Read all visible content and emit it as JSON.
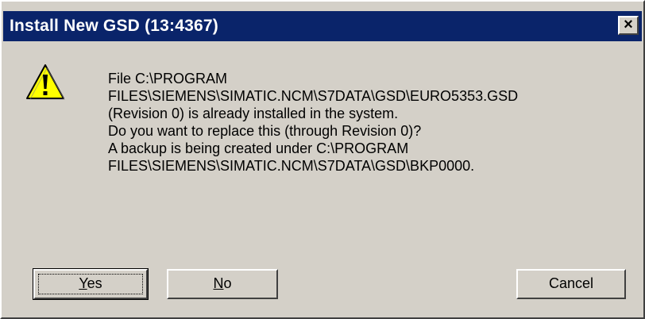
{
  "dialog": {
    "title": "Install New GSD (13:4367)",
    "close_glyph": "×",
    "icon": "warning-icon",
    "message_lines": [
      "File C:\\PROGRAM",
      "FILES\\SIEMENS\\SIMATIC.NCM\\S7DATA\\GSD\\EURO5353.GSD",
      "(Revision 0) is already installed in the system.",
      "Do you want to replace this (through Revision 0)?",
      "A backup is being created under C:\\PROGRAM",
      "FILES\\SIEMENS\\SIMATIC.NCM\\S7DATA\\GSD\\BKP0000."
    ],
    "buttons": {
      "yes": {
        "mnemonic": "Y",
        "rest": "es"
      },
      "no": {
        "mnemonic": "N",
        "rest": "o"
      },
      "cancel": "Cancel"
    }
  },
  "colors": {
    "titlebar": "#0a246a",
    "face": "#d4d0c8",
    "warning_fill": "#ffff00"
  }
}
